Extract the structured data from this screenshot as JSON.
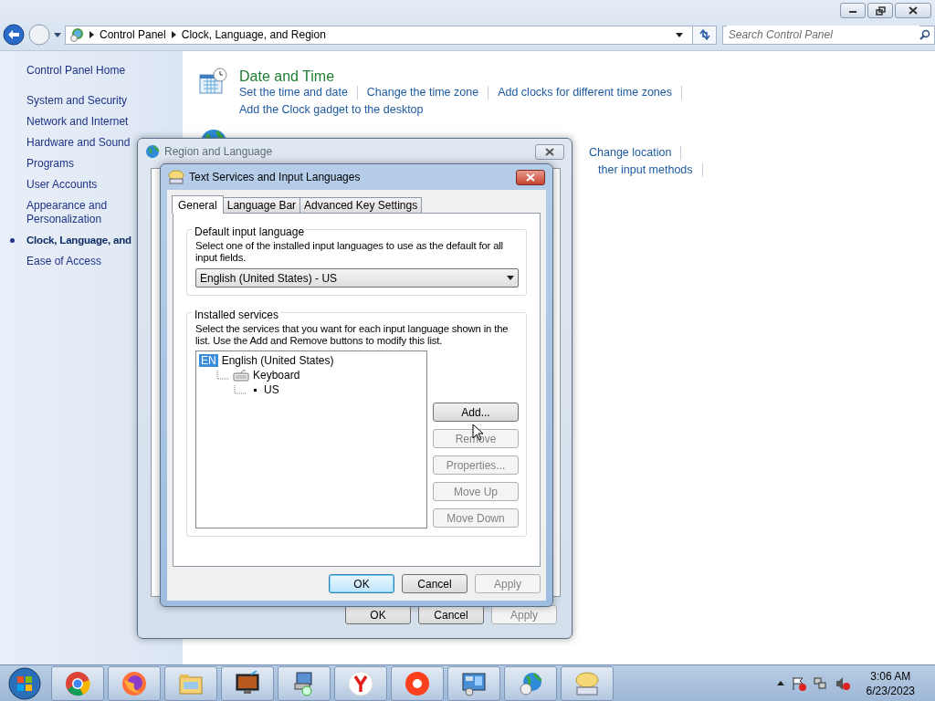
{
  "address_bar": {
    "crumbs": [
      "Control Panel",
      "Clock, Language, and Region"
    ]
  },
  "search": {
    "placeholder": "Search Control Panel"
  },
  "sidebar": {
    "home": "Control Panel Home",
    "items": [
      {
        "label": "System and Security",
        "selected": false
      },
      {
        "label": "Network and Internet",
        "selected": false
      },
      {
        "label": "Hardware and Sound",
        "selected": false
      },
      {
        "label": "Programs",
        "selected": false
      },
      {
        "label": "User Accounts",
        "selected": false
      },
      {
        "label": "Appearance and Personalization",
        "selected": false
      },
      {
        "label": "Clock, Language, and",
        "selected": true
      },
      {
        "label": "Ease of Access",
        "selected": false
      }
    ]
  },
  "categories": [
    {
      "kind": "clock",
      "title": "Date and Time",
      "links": [
        "Set the time and date",
        "Change the time zone",
        "Add clocks for different time zones",
        "Add the Clock gadget to the desktop"
      ]
    },
    {
      "kind": "globe",
      "links": [
        "Change location",
        "ther input methods"
      ]
    }
  ],
  "region_dialog": {
    "title": "Region and Language",
    "buttons": [
      {
        "label": "OK",
        "disabled": false,
        "default": false
      },
      {
        "label": "Cancel",
        "disabled": false,
        "default": false
      },
      {
        "label": "Apply",
        "disabled": true,
        "default": false
      }
    ]
  },
  "text_services_dialog": {
    "title": "Text Services and Input Languages",
    "tabs": [
      {
        "label": "General",
        "selected": true
      },
      {
        "label": "Language Bar",
        "selected": false
      },
      {
        "label": "Advanced Key Settings",
        "selected": false
      }
    ],
    "default_group": {
      "legend": "Default input language",
      "description": "Select one of the installed input languages to use as the default for all input fields.",
      "value": "English (United States) - US"
    },
    "services_group": {
      "legend": "Installed services",
      "description": "Select the services that you want for each input language shown in the list. Use the Add and Remove buttons to modify this list.",
      "tree": [
        {
          "kind": "language",
          "badge": "EN",
          "label": "English (United States)",
          "children": [
            {
              "kind": "category",
              "label": "Keyboard",
              "children": [
                {
                  "kind": "item",
                  "label": "US"
                }
              ]
            }
          ]
        }
      ],
      "buttons": [
        {
          "label": "Add...",
          "disabled": false
        },
        {
          "label": "Remove",
          "disabled": true
        },
        {
          "label": "Properties...",
          "disabled": true
        },
        {
          "label": "Move Up",
          "disabled": true
        },
        {
          "label": "Move Down",
          "disabled": true
        }
      ]
    },
    "buttons": [
      {
        "label": "OK",
        "disabled": false,
        "default": true
      },
      {
        "label": "Cancel",
        "disabled": false,
        "default": false
      },
      {
        "label": "Apply",
        "disabled": true,
        "default": false
      }
    ]
  },
  "taskbar": {
    "clock": {
      "time": "3:06 AM",
      "date": "6/23/2023"
    }
  }
}
